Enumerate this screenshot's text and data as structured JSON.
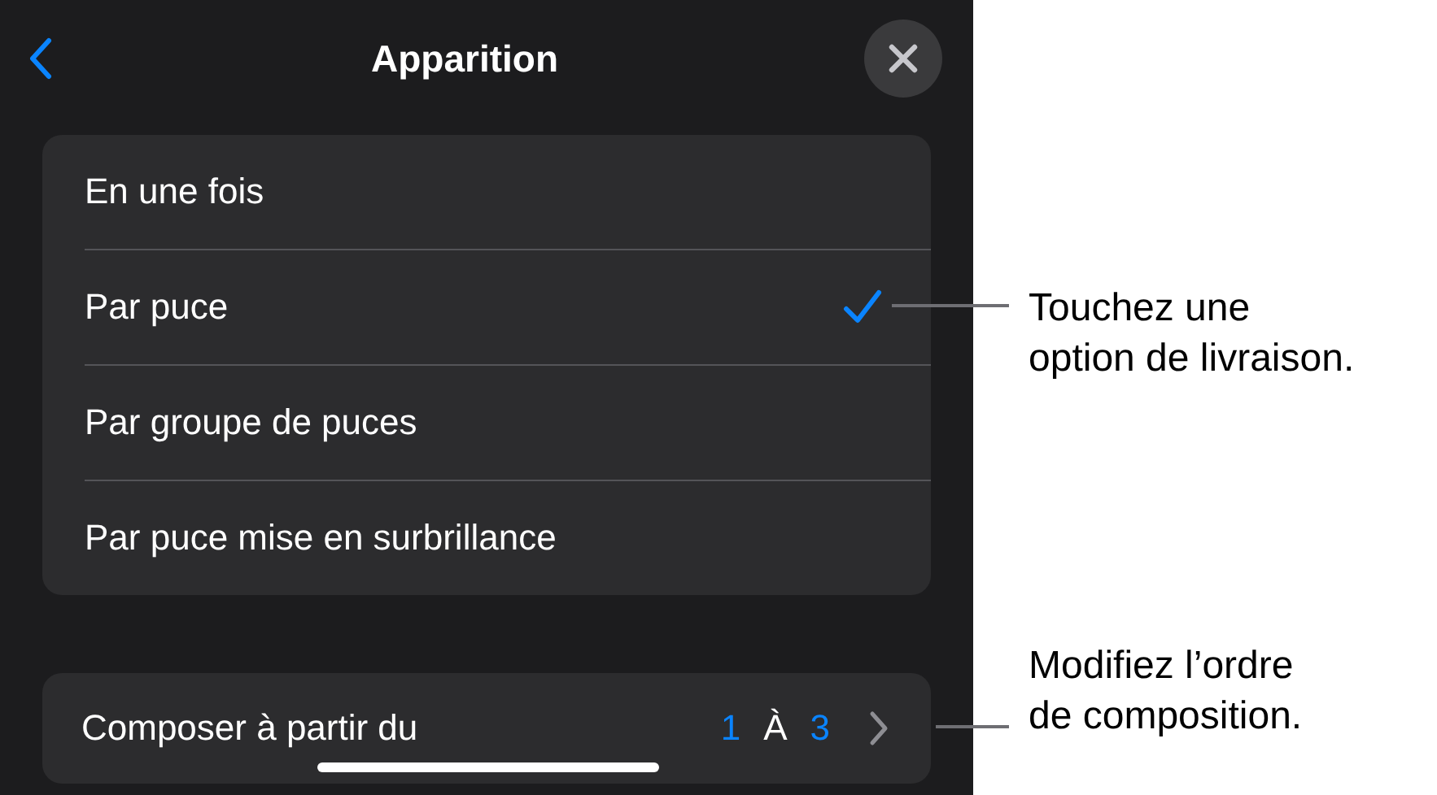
{
  "header": {
    "title": "Apparition"
  },
  "options": [
    {
      "label": "En une fois",
      "selected": false
    },
    {
      "label": "Par puce",
      "selected": true
    },
    {
      "label": "Par groupe de puces",
      "selected": false
    },
    {
      "label": "Par puce mise en surbrillance",
      "selected": false
    }
  ],
  "build": {
    "label": "Composer à partir du",
    "from": "1",
    "separator": "À",
    "to": "3"
  },
  "callouts": [
    {
      "text": "Touchez une\noption de livraison."
    },
    {
      "text": "Modifiez l’ordre\nde composition."
    }
  ]
}
